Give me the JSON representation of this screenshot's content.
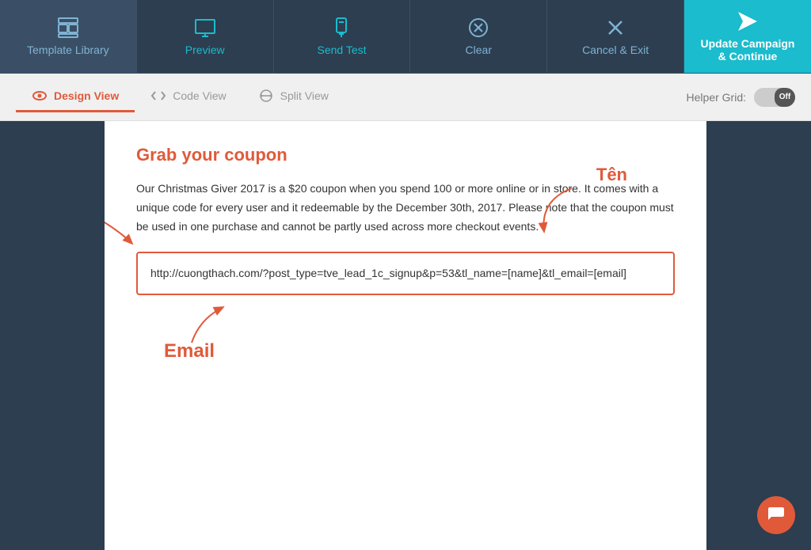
{
  "toolbar": {
    "template_library_label": "Template Library",
    "preview_label": "Preview",
    "send_test_label": "Send Test",
    "clear_label": "Clear",
    "cancel_exit_label": "Cancel & Exit",
    "update_campaign_label": "Update Campaign\n& Continue"
  },
  "view_bar": {
    "design_view_label": "Design View",
    "code_view_label": "Code View",
    "split_view_label": "Split View",
    "helper_grid_label": "Helper Grid:",
    "toggle_label": "Off"
  },
  "email_content": {
    "heading": "Grab your coupon",
    "body": "Our Christmas Giver 2017 is a $20 coupon when you spend 100 or more online or in store. It comes with a unique code for every user and it redeemable by the December 30th, 2017. Please note that the coupon must be used in one purchase and cannot be partly used across more checkout events.",
    "url": "http://cuongthach.com/?post_type=tve_lead_1c_signup&p=53&tl_name=[name]&tl_email=[email]"
  },
  "annotations": {
    "ten_label": "Tên",
    "email_label": "Email"
  }
}
